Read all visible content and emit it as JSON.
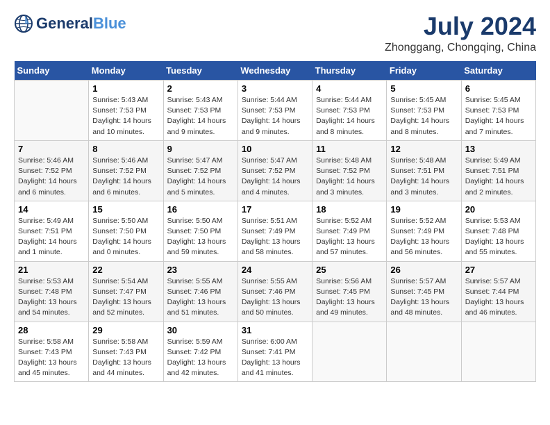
{
  "header": {
    "logo_line1": "General",
    "logo_line2": "Blue",
    "month": "July 2024",
    "location": "Zhonggang, Chongqing, China"
  },
  "weekdays": [
    "Sunday",
    "Monday",
    "Tuesday",
    "Wednesday",
    "Thursday",
    "Friday",
    "Saturday"
  ],
  "weeks": [
    [
      {
        "day": "",
        "info": ""
      },
      {
        "day": "1",
        "info": "Sunrise: 5:43 AM\nSunset: 7:53 PM\nDaylight: 14 hours\nand 10 minutes."
      },
      {
        "day": "2",
        "info": "Sunrise: 5:43 AM\nSunset: 7:53 PM\nDaylight: 14 hours\nand 9 minutes."
      },
      {
        "day": "3",
        "info": "Sunrise: 5:44 AM\nSunset: 7:53 PM\nDaylight: 14 hours\nand 9 minutes."
      },
      {
        "day": "4",
        "info": "Sunrise: 5:44 AM\nSunset: 7:53 PM\nDaylight: 14 hours\nand 8 minutes."
      },
      {
        "day": "5",
        "info": "Sunrise: 5:45 AM\nSunset: 7:53 PM\nDaylight: 14 hours\nand 8 minutes."
      },
      {
        "day": "6",
        "info": "Sunrise: 5:45 AM\nSunset: 7:53 PM\nDaylight: 14 hours\nand 7 minutes."
      }
    ],
    [
      {
        "day": "7",
        "info": "Sunrise: 5:46 AM\nSunset: 7:52 PM\nDaylight: 14 hours\nand 6 minutes."
      },
      {
        "day": "8",
        "info": "Sunrise: 5:46 AM\nSunset: 7:52 PM\nDaylight: 14 hours\nand 6 minutes."
      },
      {
        "day": "9",
        "info": "Sunrise: 5:47 AM\nSunset: 7:52 PM\nDaylight: 14 hours\nand 5 minutes."
      },
      {
        "day": "10",
        "info": "Sunrise: 5:47 AM\nSunset: 7:52 PM\nDaylight: 14 hours\nand 4 minutes."
      },
      {
        "day": "11",
        "info": "Sunrise: 5:48 AM\nSunset: 7:52 PM\nDaylight: 14 hours\nand 3 minutes."
      },
      {
        "day": "12",
        "info": "Sunrise: 5:48 AM\nSunset: 7:51 PM\nDaylight: 14 hours\nand 3 minutes."
      },
      {
        "day": "13",
        "info": "Sunrise: 5:49 AM\nSunset: 7:51 PM\nDaylight: 14 hours\nand 2 minutes."
      }
    ],
    [
      {
        "day": "14",
        "info": "Sunrise: 5:49 AM\nSunset: 7:51 PM\nDaylight: 14 hours\nand 1 minute."
      },
      {
        "day": "15",
        "info": "Sunrise: 5:50 AM\nSunset: 7:50 PM\nDaylight: 14 hours\nand 0 minutes."
      },
      {
        "day": "16",
        "info": "Sunrise: 5:50 AM\nSunset: 7:50 PM\nDaylight: 13 hours\nand 59 minutes."
      },
      {
        "day": "17",
        "info": "Sunrise: 5:51 AM\nSunset: 7:49 PM\nDaylight: 13 hours\nand 58 minutes."
      },
      {
        "day": "18",
        "info": "Sunrise: 5:52 AM\nSunset: 7:49 PM\nDaylight: 13 hours\nand 57 minutes."
      },
      {
        "day": "19",
        "info": "Sunrise: 5:52 AM\nSunset: 7:49 PM\nDaylight: 13 hours\nand 56 minutes."
      },
      {
        "day": "20",
        "info": "Sunrise: 5:53 AM\nSunset: 7:48 PM\nDaylight: 13 hours\nand 55 minutes."
      }
    ],
    [
      {
        "day": "21",
        "info": "Sunrise: 5:53 AM\nSunset: 7:48 PM\nDaylight: 13 hours\nand 54 minutes."
      },
      {
        "day": "22",
        "info": "Sunrise: 5:54 AM\nSunset: 7:47 PM\nDaylight: 13 hours\nand 52 minutes."
      },
      {
        "day": "23",
        "info": "Sunrise: 5:55 AM\nSunset: 7:46 PM\nDaylight: 13 hours\nand 51 minutes."
      },
      {
        "day": "24",
        "info": "Sunrise: 5:55 AM\nSunset: 7:46 PM\nDaylight: 13 hours\nand 50 minutes."
      },
      {
        "day": "25",
        "info": "Sunrise: 5:56 AM\nSunset: 7:45 PM\nDaylight: 13 hours\nand 49 minutes."
      },
      {
        "day": "26",
        "info": "Sunrise: 5:57 AM\nSunset: 7:45 PM\nDaylight: 13 hours\nand 48 minutes."
      },
      {
        "day": "27",
        "info": "Sunrise: 5:57 AM\nSunset: 7:44 PM\nDaylight: 13 hours\nand 46 minutes."
      }
    ],
    [
      {
        "day": "28",
        "info": "Sunrise: 5:58 AM\nSunset: 7:43 PM\nDaylight: 13 hours\nand 45 minutes."
      },
      {
        "day": "29",
        "info": "Sunrise: 5:58 AM\nSunset: 7:43 PM\nDaylight: 13 hours\nand 44 minutes."
      },
      {
        "day": "30",
        "info": "Sunrise: 5:59 AM\nSunset: 7:42 PM\nDaylight: 13 hours\nand 42 minutes."
      },
      {
        "day": "31",
        "info": "Sunrise: 6:00 AM\nSunset: 7:41 PM\nDaylight: 13 hours\nand 41 minutes."
      },
      {
        "day": "",
        "info": ""
      },
      {
        "day": "",
        "info": ""
      },
      {
        "day": "",
        "info": ""
      }
    ]
  ]
}
